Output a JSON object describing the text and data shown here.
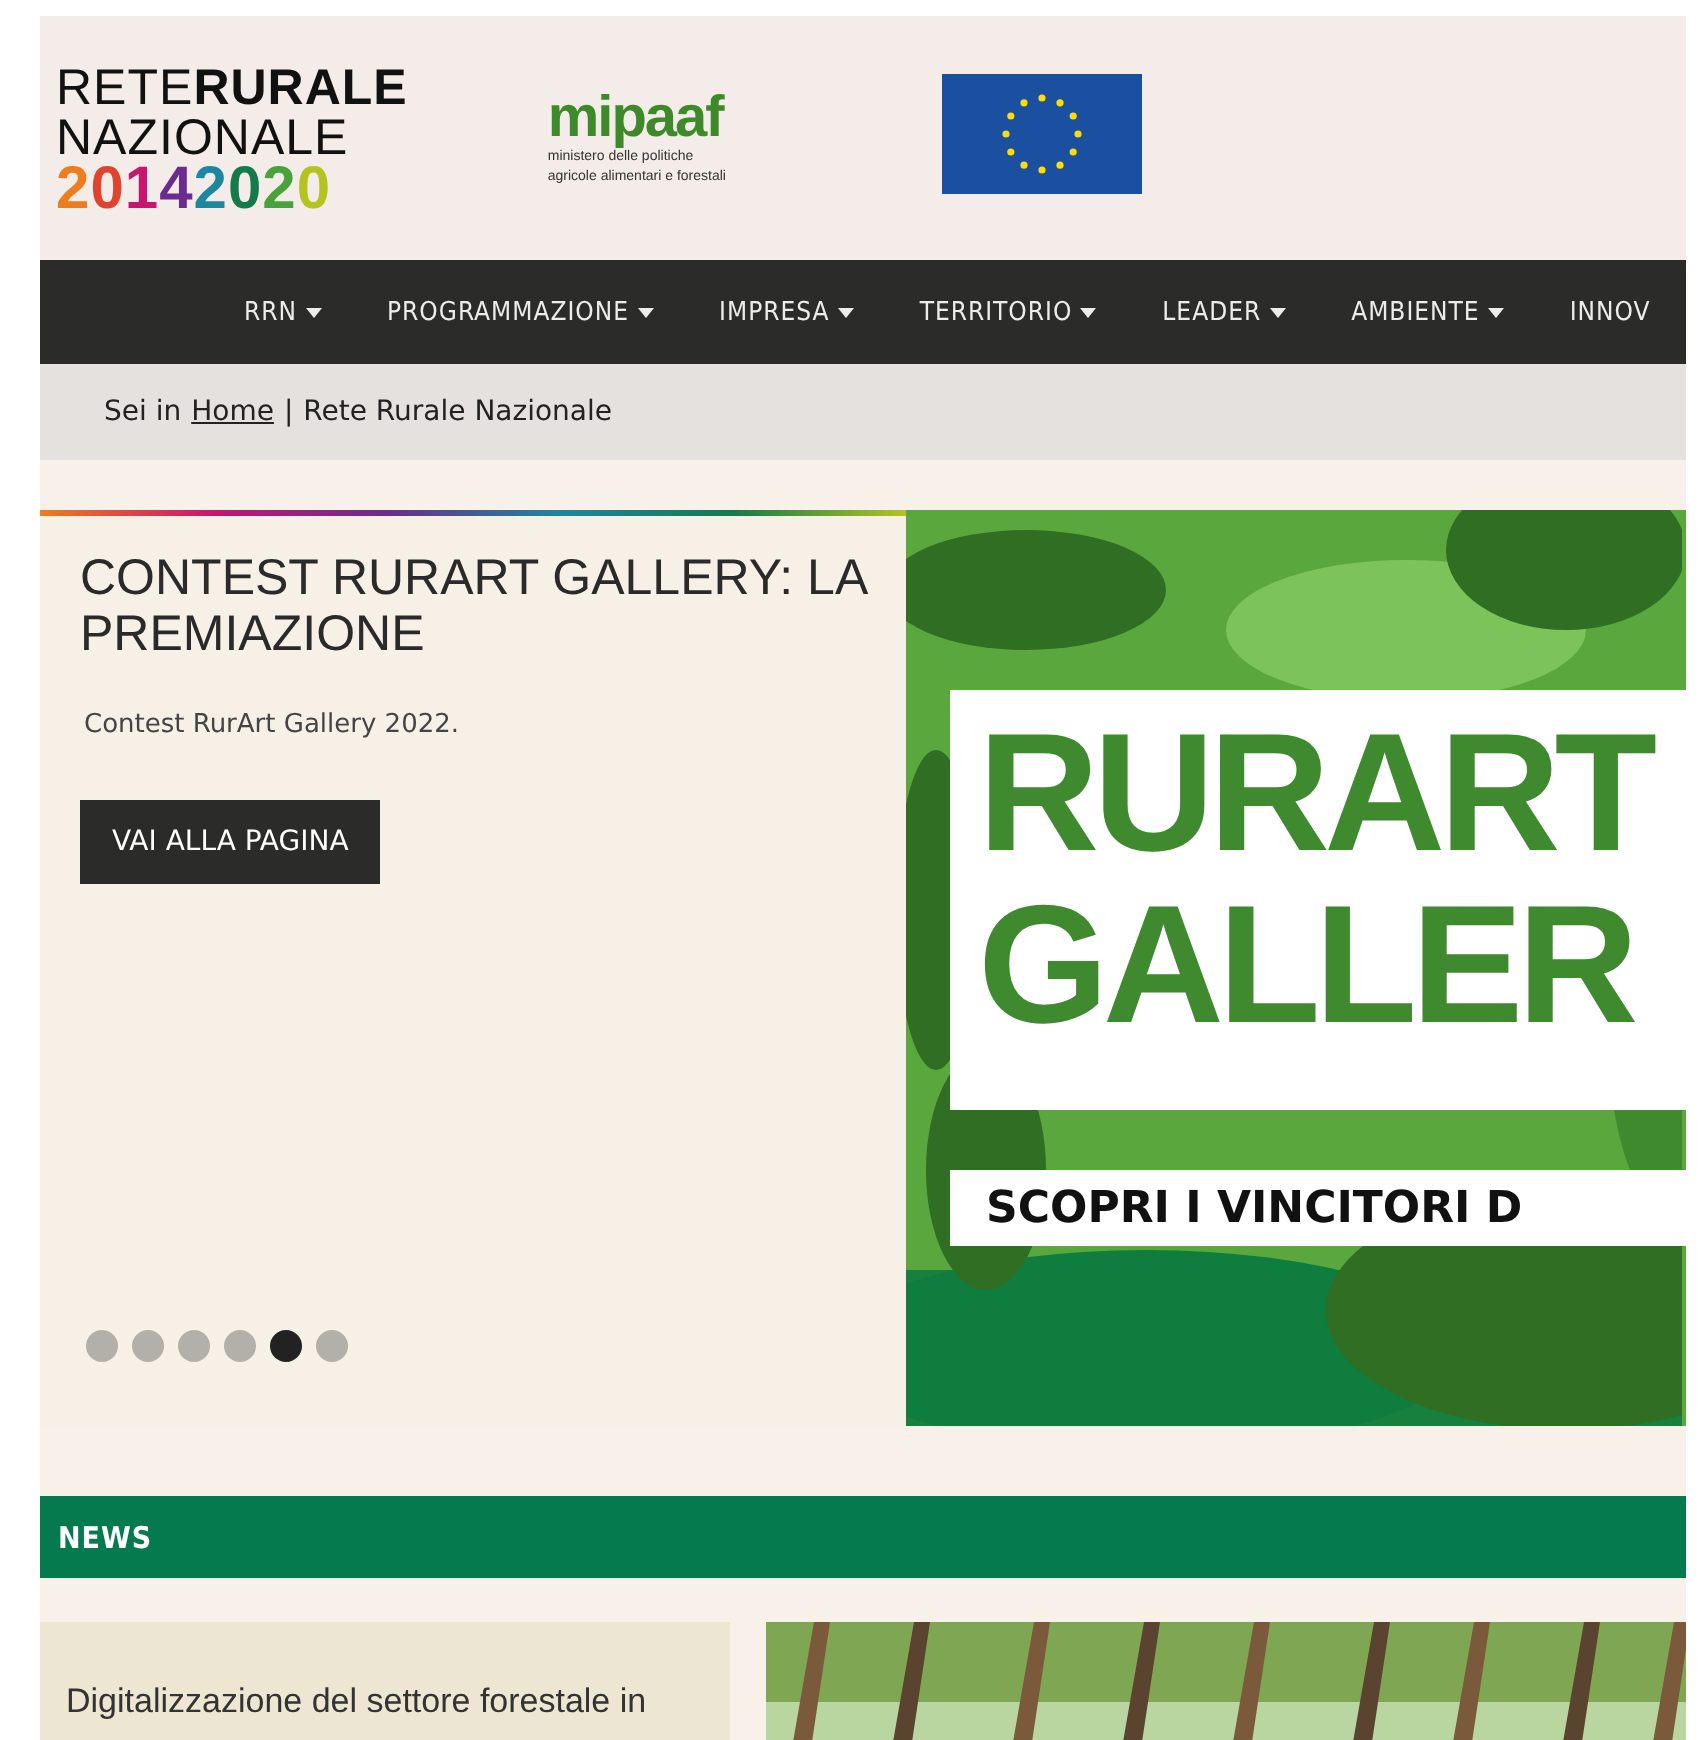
{
  "header": {
    "logo": {
      "line_1_light": "RETE",
      "line_1_bold": "RURALE",
      "line_2": "NAZIONALE",
      "digits": [
        {
          "text": "2",
          "color": "#ee7d1f"
        },
        {
          "text": "0",
          "color": "#e0442e"
        },
        {
          "text": "1",
          "color": "#c8156f"
        },
        {
          "text": "4",
          "color": "#6a2c8e"
        },
        {
          "text": "2",
          "color": "#1d87a0"
        },
        {
          "text": "0",
          "color": "#137a4c"
        },
        {
          "text": "2",
          "color": "#4aa33a"
        },
        {
          "text": "0",
          "color": "#b5c321"
        }
      ]
    },
    "ministry": {
      "name": "mipaaf",
      "subtitle_1": "ministero delle politiche",
      "subtitle_2": "agricole alimentari e forestali"
    }
  },
  "nav": [
    {
      "label": "RRN",
      "has_caret": true
    },
    {
      "label": "PROGRAMMAZIONE",
      "has_caret": true
    },
    {
      "label": "IMPRESA",
      "has_caret": true
    },
    {
      "label": "TERRITORIO",
      "has_caret": true
    },
    {
      "label": "LEADER",
      "has_caret": true
    },
    {
      "label": "AMBIENTE",
      "has_caret": true
    },
    {
      "label": "INNOV",
      "has_caret": false
    }
  ],
  "breadcrumb": {
    "prefix": "Sei in",
    "link": "Home",
    "separator": "|",
    "current": "Rete Rurale Nazionale"
  },
  "slider": {
    "title": "CONTEST RURART GALLERY: LA PREMIAZIONE",
    "text": "Contest RurArt Gallery 2022.",
    "button": "VAI ALLA PAGINA",
    "banner": {
      "line_1": "RURART",
      "line_2": "GALLER",
      "tagline": "SCOPRI I VINCITORI D"
    },
    "dots": [
      {
        "selected": false
      },
      {
        "selected": false
      },
      {
        "selected": false
      },
      {
        "selected": false
      },
      {
        "selected": true
      },
      {
        "selected": false
      }
    ]
  },
  "news": {
    "heading": "NEWS",
    "cards": [
      {
        "kind": "text",
        "title": "Digitalizzazione del settore forestale in"
      },
      {
        "kind": "picture"
      }
    ]
  }
}
